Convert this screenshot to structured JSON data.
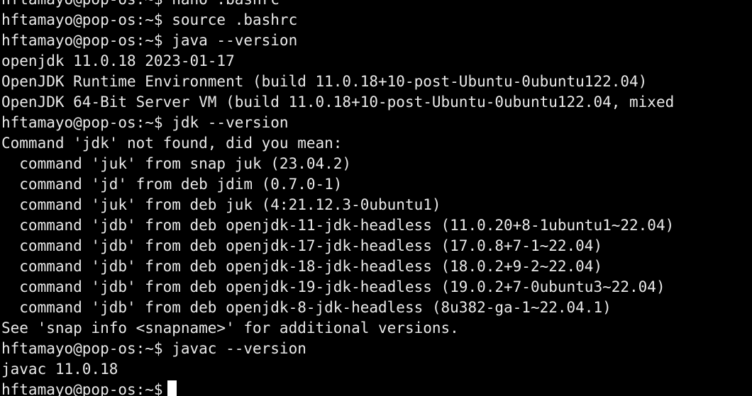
{
  "terminal": {
    "prompt": "hftamayo@pop-os:~$",
    "lines": [
      "hftamayo@pop-os:~$ nano .bashrc",
      "hftamayo@pop-os:~$ source .bashrc",
      "hftamayo@pop-os:~$ java --version",
      "openjdk 11.0.18 2023-01-17",
      "OpenJDK Runtime Environment (build 11.0.18+10-post-Ubuntu-0ubuntu122.04)",
      "OpenJDK 64-Bit Server VM (build 11.0.18+10-post-Ubuntu-0ubuntu122.04, mixed",
      "hftamayo@pop-os:~$ jdk --version",
      "Command 'jdk' not found, did you mean:",
      "  command 'juk' from snap juk (23.04.2)",
      "  command 'jd' from deb jdim (0.7.0-1)",
      "  command 'juk' from deb juk (4:21.12.3-0ubuntu1)",
      "  command 'jdb' from deb openjdk-11-jdk-headless (11.0.20+8-1ubuntu1~22.04)",
      "  command 'jdb' from deb openjdk-17-jdk-headless (17.0.8+7-1~22.04)",
      "  command 'jdb' from deb openjdk-18-jdk-headless (18.0.2+9-2~22.04)",
      "  command 'jdb' from deb openjdk-19-jdk-headless (19.0.2+7-0ubuntu3~22.04)",
      "  command 'jdb' from deb openjdk-8-jdk-headless (8u382-ga-1~22.04.1)",
      "See 'snap info <snapname>' for additional versions.",
      "hftamayo@pop-os:~$ javac --version",
      "javac 11.0.18"
    ]
  }
}
